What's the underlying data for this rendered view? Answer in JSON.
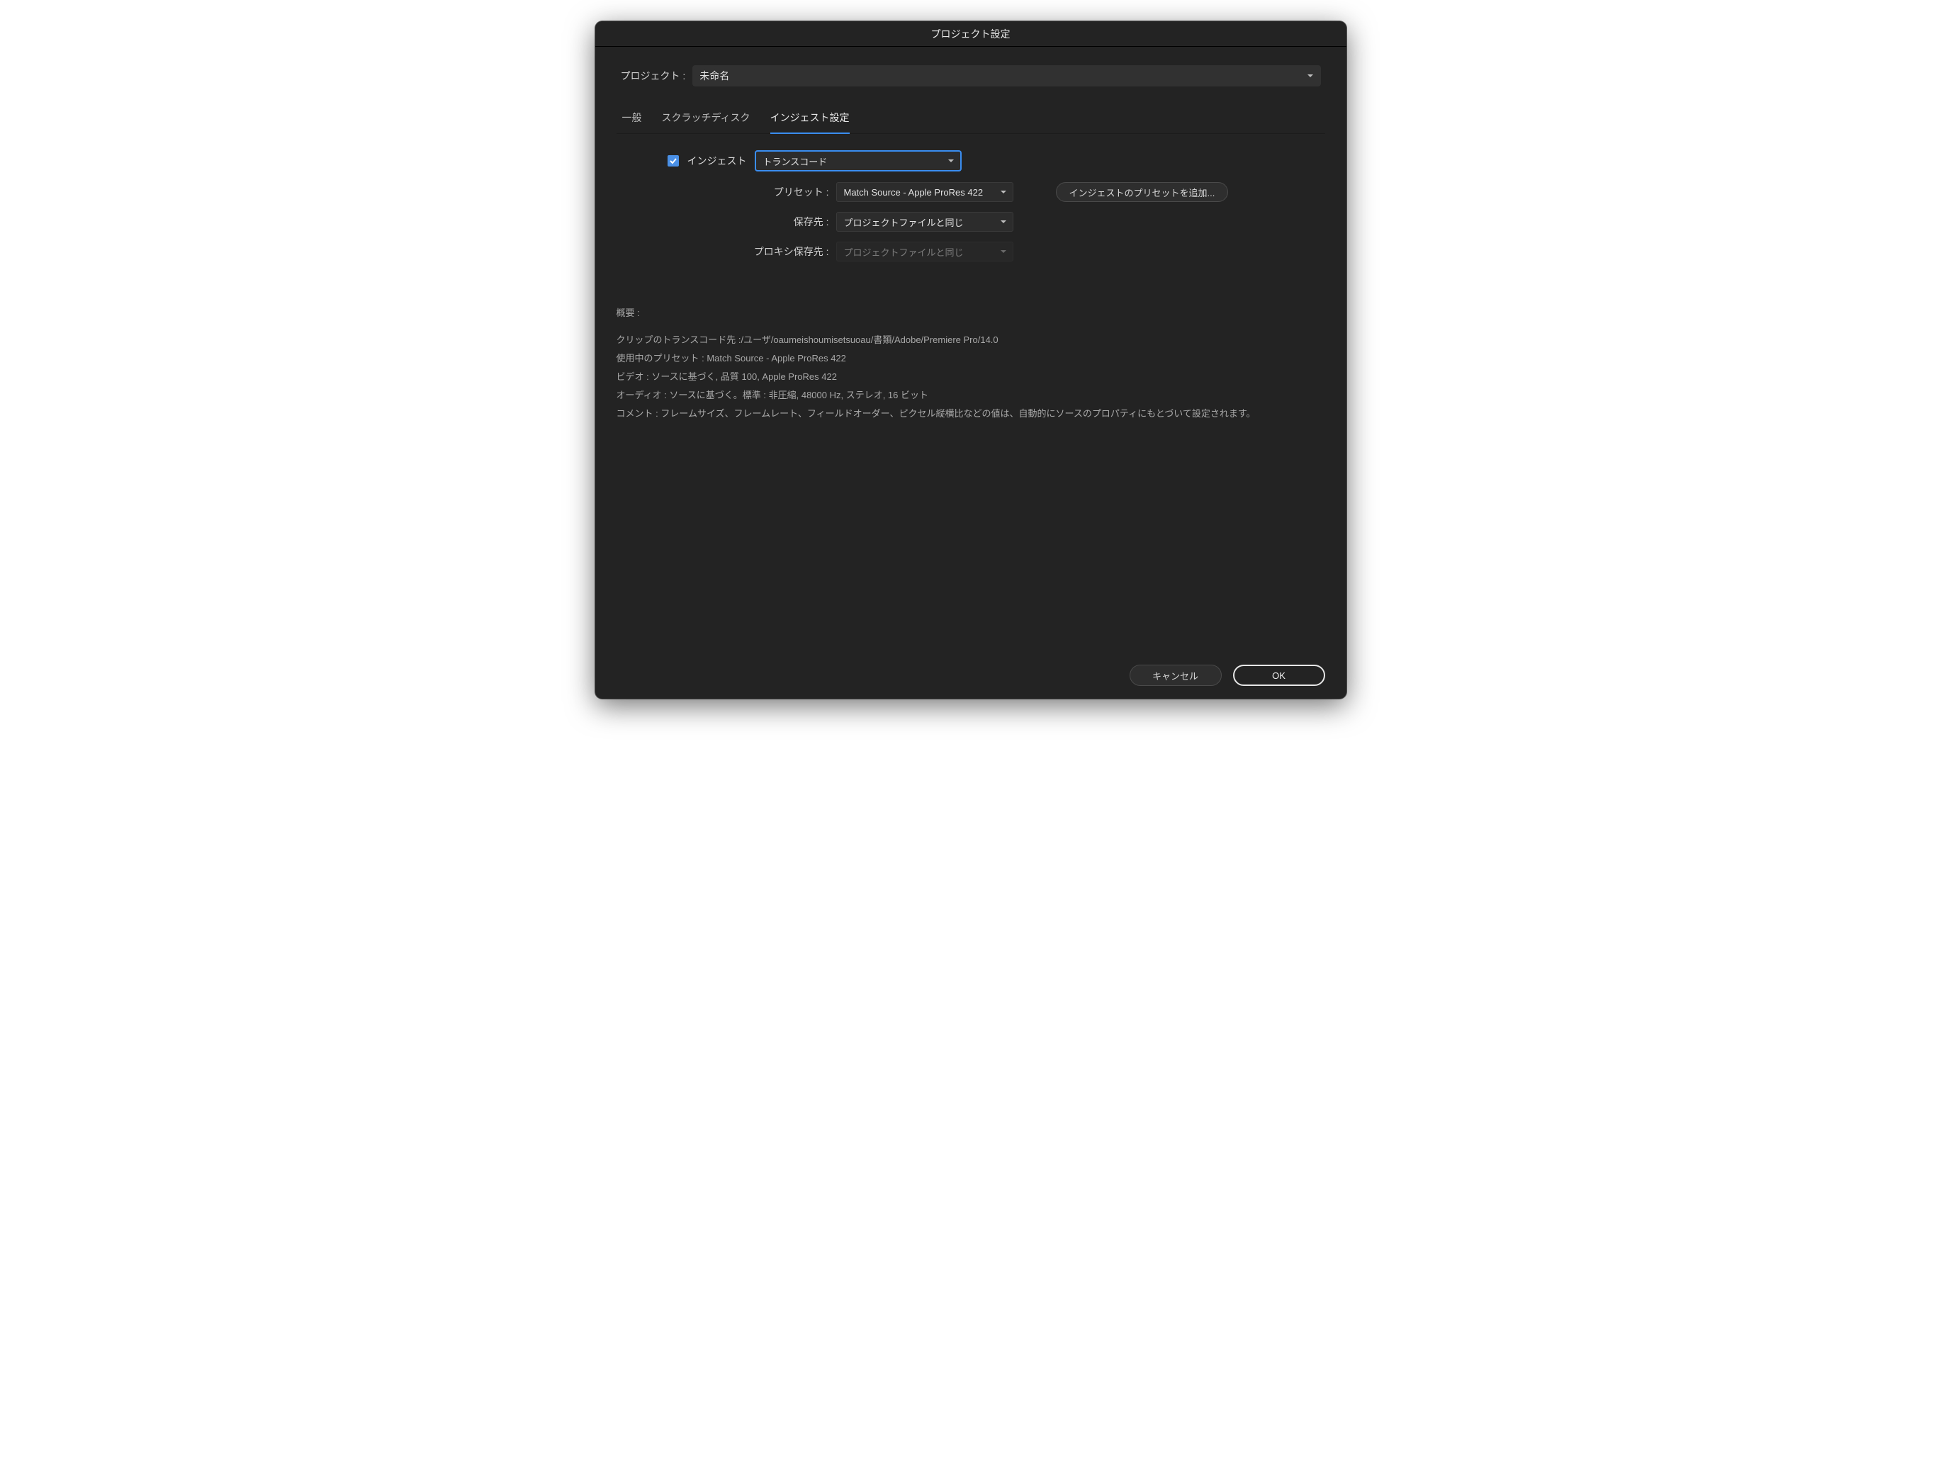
{
  "window": {
    "title": "プロジェクト設定"
  },
  "project": {
    "label": "プロジェクト :",
    "value": "未命名"
  },
  "tabs": {
    "general": "一般",
    "scratch": "スクラッチディスク",
    "ingest": "インジェスト設定"
  },
  "ingest": {
    "checkboxLabel": "インジェスト",
    "modeValue": "トランスコード",
    "presetLabel": "プリセット :",
    "presetValue": "Match Source - Apple ProRes 422",
    "destLabel": "保存先 :",
    "destValue": "プロジェクトファイルと同じ",
    "proxyDestLabel": "プロキシ保存先 :",
    "proxyDestValue": "プロジェクトファイルと同じ",
    "addPresetLabel": "インジェストのプリセットを追加..."
  },
  "summary": {
    "header": "概要 :",
    "line1": "クリップのトランスコード先 :/ユーザ/oaumeishoumisetsuoau/書類/Adobe/Premiere Pro/14.0",
    "line2": "使用中のプリセット : Match Source - Apple ProRes 422",
    "line3": "ビデオ : ソースに基づく, 品質 100, Apple ProRes 422",
    "line4": "オーディオ : ソースに基づく。標準 : 非圧縮, 48000 Hz, ステレオ, 16 ビット",
    "line5": "コメント : フレームサイズ、フレームレート、フィールドオーダー、ピクセル縦横比などの値は、自動的にソースのプロパティにもとづいて設定されます。"
  },
  "footer": {
    "cancel": "キャンセル",
    "ok": "OK"
  }
}
